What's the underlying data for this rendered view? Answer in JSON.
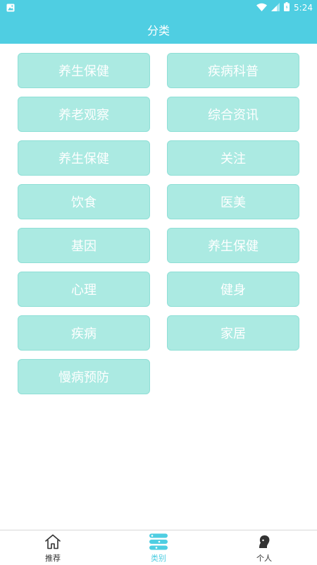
{
  "status_bar": {
    "time": "5:24"
  },
  "app_bar": {
    "title": "分类"
  },
  "categories": [
    "养生保健",
    "疾病科普",
    "养老观察",
    "综合资讯",
    "养生保健",
    "关注",
    "饮食",
    "医美",
    "基因",
    "养生保健",
    "心理",
    "健身",
    "疾病",
    "家居",
    "慢病预防"
  ],
  "bottom_nav": {
    "items": [
      {
        "label": "推荐",
        "icon": "home-icon"
      },
      {
        "label": "类别",
        "icon": "category-icon",
        "active": true
      },
      {
        "label": "个人",
        "icon": "person-icon"
      }
    ]
  },
  "colors": {
    "accent": "#4fcee2",
    "button_bg": "#abeae2",
    "button_border": "#8fdfd6",
    "text_white": "#ffffff"
  }
}
